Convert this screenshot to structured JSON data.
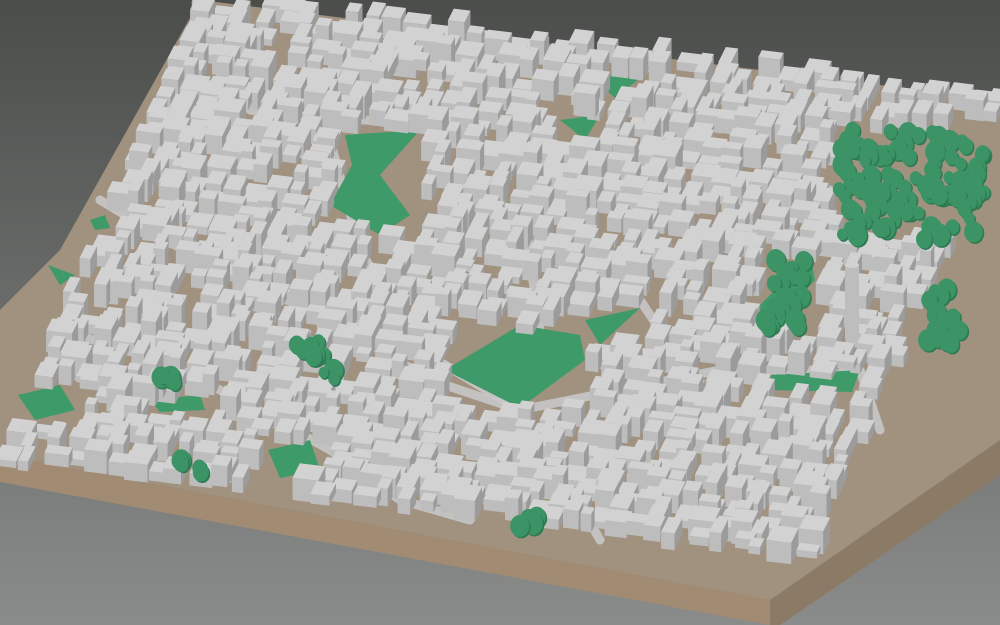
{
  "viewport": {
    "background_top": "#4b4d4b",
    "background_bottom": "#8a8c8b"
  },
  "model": {
    "ground_color": "#a1917f",
    "base_front_color": "#a18b73",
    "base_side_color": "#8a7a66",
    "building_roof_color": "#d2d2d2",
    "building_wall_light": "#bdbdbd",
    "building_wall_dark": "#9b9b9b",
    "street_color": "#c8c8c8",
    "park_color": "#3f9a6a",
    "tree_color": "#3c9466",
    "tree_shadow_color": "#2e7a52"
  }
}
